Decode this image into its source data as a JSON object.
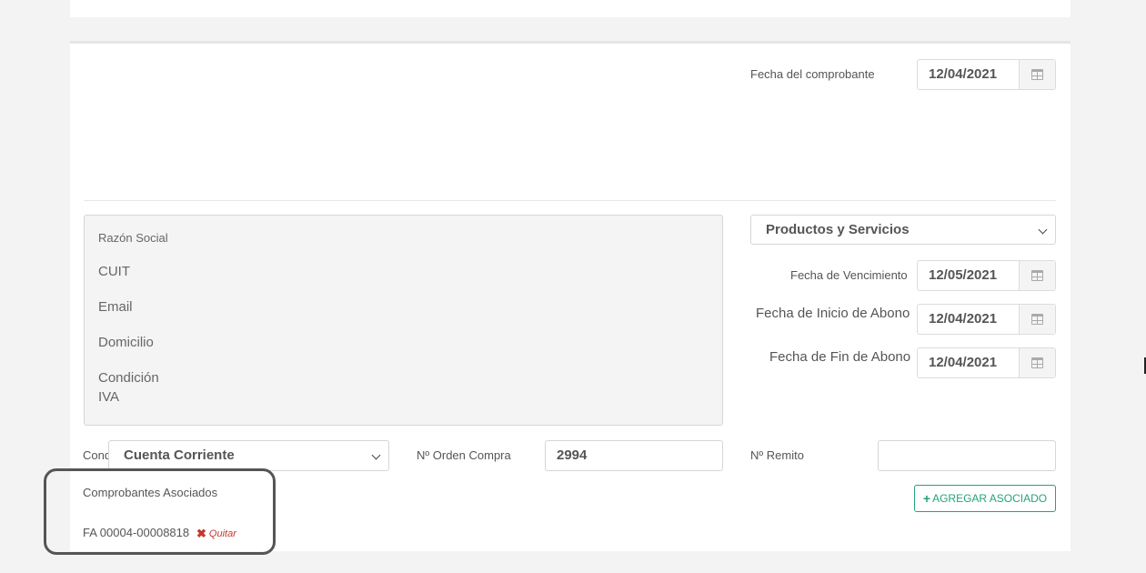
{
  "header": {
    "fecha_comprobante_label": "Fecha del comprobante",
    "fecha_comprobante_value": "12/04/2021"
  },
  "client": {
    "razon_social_label": "Razón Social",
    "cuit_label": "CUIT",
    "email_label": "Email",
    "domicilio_label": "Domicilio",
    "condicion_label_1": "Condición",
    "condicion_label_2": "IVA"
  },
  "right": {
    "concepto_selected": "Productos y Servicios",
    "vencimiento_label": "Fecha de Vencimiento",
    "vencimiento_value": "12/05/2021",
    "inicio_abono_label": "Fecha de Inicio de Abono",
    "inicio_abono_value": "12/04/2021",
    "fin_abono_label": "Fecha de Fin de Abono",
    "fin_abono_value": "12/04/2021"
  },
  "bottom": {
    "condicion_label": "Cond",
    "condicion_selected": "Cuenta Corriente",
    "orden_compra_label": "Nº Orden Compra",
    "orden_compra_value": "2994",
    "remito_label": "Nº Remito",
    "remito_value": ""
  },
  "asociados": {
    "title": "Comprobantes Asociados",
    "add_button": "AGREGAR ASOCIADO",
    "add_icon": "plus-icon",
    "items": [
      {
        "number": "FA 00004-00008818",
        "remove_label": "Quitar",
        "remove_icon": "close-icon"
      }
    ]
  },
  "colors": {
    "accent_green": "#26a37a",
    "remove_red": "#c0392b"
  }
}
